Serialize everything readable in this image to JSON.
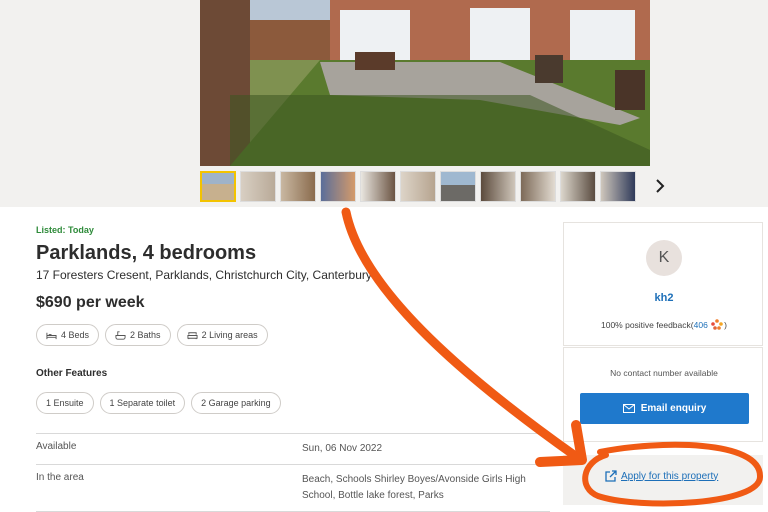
{
  "listing": {
    "listed": "Listed: Today",
    "title": "Parklands, 4 bedrooms",
    "address": "17 Foresters Cresent, Parklands, Christchurch City, Canterbury",
    "price": "$690 per week"
  },
  "chips": {
    "beds": "4 Beds",
    "baths": "2 Baths",
    "living": "2 Living areas"
  },
  "other_features": {
    "heading": "Other Features",
    "items": [
      "1 Ensuite",
      "1 Separate toilet",
      "2 Garage parking"
    ]
  },
  "details": [
    {
      "label": "Available",
      "value": "Sun, 06 Nov 2022"
    },
    {
      "label": "In the area",
      "value": "Beach, Schools Shirley Boyes/Avonside Girls High School, Bottle lake forest, Parks"
    }
  ],
  "seller": {
    "initial": "K",
    "name": "kh2",
    "feedback_prefix": "100% positive feedback(",
    "feedback_count": "406",
    "feedback_suffix": ")",
    "no_contact": "No contact number available",
    "email_button": "Email enquiry",
    "apply_link": "Apply for this property"
  },
  "colors": {
    "accent": "#1f79cc",
    "listed_green": "#2e8b3a",
    "annotation": "#f05a14"
  }
}
